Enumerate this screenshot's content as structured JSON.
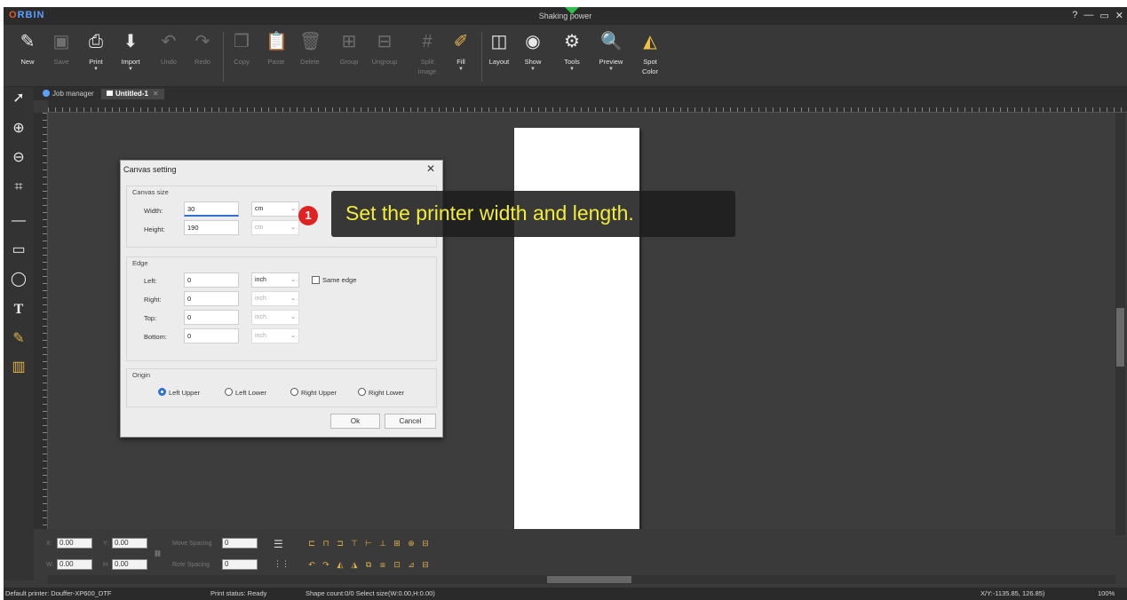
{
  "titlebar": {
    "logo_prefix": "O",
    "logo_rest": "RBIN",
    "title": "Shaking power",
    "controls": [
      "?",
      "—",
      "▭",
      "✕"
    ]
  },
  "toolbar": {
    "new": "New",
    "save": "Save",
    "print": "Print",
    "import": "Import",
    "undo": "Undo",
    "redo": "Redo",
    "copy": "Copy",
    "paste": "Paste",
    "delete": "Delete",
    "group": "Group",
    "ungroup": "Ungroup",
    "split_line1": "Split",
    "split_line2": "image",
    "fill": "Fill",
    "layout": "Layout",
    "show": "Show",
    "tools": "Tools",
    "preview": "Preview",
    "spot_line1": "Spot",
    "spot_line2": "Color"
  },
  "tabs": {
    "job_manager": "Job manager",
    "untitled": "Untitled-1",
    "close": "✕"
  },
  "dialog": {
    "title": "Canvas setting",
    "close": "✕",
    "canvas_size": {
      "label": "Canvas size",
      "width_label": "Width:",
      "width_value": "30",
      "height_label": "Height:",
      "height_value": "190",
      "unit": "cm",
      "unit2": "cm"
    },
    "edge": {
      "label": "Edge",
      "left_label": "Left:",
      "left_value": "0",
      "right_label": "Right:",
      "right_value": "0",
      "top_label": "Top:",
      "top_value": "0",
      "bottom_label": "Bottom:",
      "bottom_value": "0",
      "unit": "inch",
      "same_edge": "Same edge"
    },
    "origin": {
      "label": "Origin",
      "options": [
        "Left Upper",
        "Left Lower",
        "Right Upper",
        "Right Lower"
      ],
      "selected": "Left Upper"
    },
    "ok": "Ok",
    "cancel": "Cancel"
  },
  "tooltip": {
    "step": "1",
    "text": "Set the printer width and length."
  },
  "props": {
    "x_label": "X:",
    "x_value": "0.00",
    "y_label": "Y:",
    "y_value": "0.00",
    "w_label": "W:",
    "w_value": "0.00",
    "h_label": "H:",
    "h_value": "0.00",
    "move_spacing_label": "Move Spacing",
    "move_spacing_value": "0",
    "rotate_spacing_label": "Rote Spacing",
    "rotate_spacing_value": "0"
  },
  "status": {
    "printer": "Default printer: Douffer-XP600_DTF",
    "print_status": "Print status: Ready",
    "shape_count": "Shape count:0/0  Select size(W:0.00,H:0.00)",
    "coords": "X/Y:-1135.85, 126.85)",
    "zoom": "100%"
  },
  "colors": {
    "accent": "#2f6fd6",
    "tooltip_text": "#f2ec3a",
    "badge": "#e02222",
    "marker": "#2fbf4a"
  }
}
